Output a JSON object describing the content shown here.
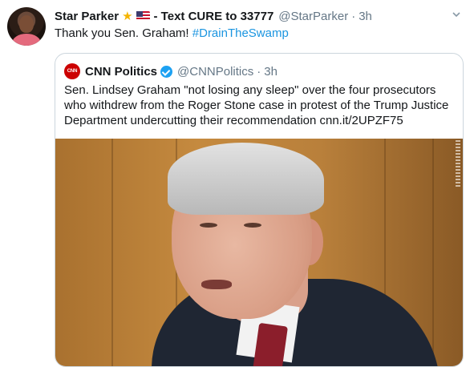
{
  "tweet": {
    "author_name": "Star Parker",
    "author_suffix": "- Text CURE to 33777",
    "handle": "@StarParker",
    "separator": "·",
    "time": "3h",
    "text_before": "Thank you Sen. Graham! ",
    "hashtag": "#DrainTheSwamp",
    "star_icon": "star-icon",
    "flag_icon": "us-flag-icon",
    "menu_icon": "chevron-down-icon"
  },
  "quoted": {
    "logo_text": "CNN",
    "author_name": "CNN Politics",
    "handle": "@CNNPolitics",
    "separator": "·",
    "time": "3h",
    "text": "Sen. Lindsey Graham \"not losing any sleep\" over the four prosecutors who withdrew from the Roger Stone case in protest of the Trump Justice Department undercutting their recommendation cnn.it/2UPZF75"
  },
  "colors": {
    "link": "#1b95e0",
    "verified": "#1da1f2",
    "muted": "#657786",
    "cnn_red": "#cc0000"
  }
}
